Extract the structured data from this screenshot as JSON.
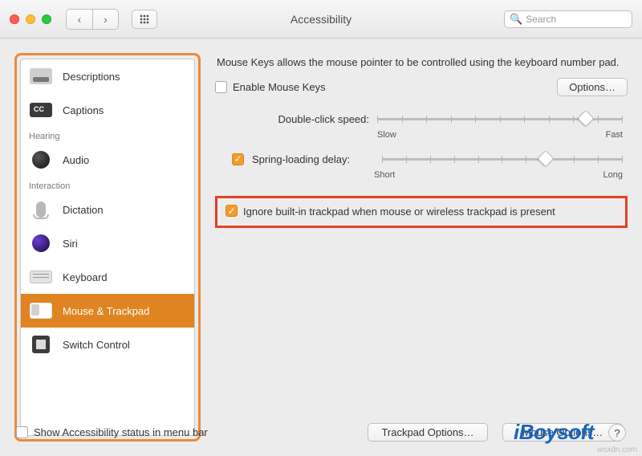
{
  "window": {
    "title": "Accessibility",
    "search_placeholder": "Search"
  },
  "sidebar": {
    "sections": [
      {
        "header": null,
        "items": [
          {
            "id": "descriptions",
            "label": "Descriptions"
          },
          {
            "id": "captions",
            "label": "Captions"
          }
        ]
      },
      {
        "header": "Hearing",
        "items": [
          {
            "id": "audio",
            "label": "Audio"
          }
        ]
      },
      {
        "header": "Interaction",
        "items": [
          {
            "id": "dictation",
            "label": "Dictation"
          },
          {
            "id": "siri",
            "label": "Siri"
          },
          {
            "id": "keyboard",
            "label": "Keyboard"
          },
          {
            "id": "mouse-trackpad",
            "label": "Mouse & Trackpad",
            "selected": true
          },
          {
            "id": "switch-control",
            "label": "Switch Control"
          }
        ]
      }
    ]
  },
  "main": {
    "intro": "Mouse Keys allows the mouse pointer to be controlled using the keyboard number pad.",
    "enable_mouse_keys": {
      "label": "Enable Mouse Keys",
      "checked": false
    },
    "options_button": "Options…",
    "sliders": {
      "dclick": {
        "label": "Double-click speed:",
        "min_label": "Slow",
        "max_label": "Fast",
        "value_pct": 85,
        "checked": null
      },
      "spring": {
        "label": "Spring-loading delay:",
        "min_label": "Short",
        "max_label": "Long",
        "value_pct": 68,
        "checked": true
      }
    },
    "ignore_trackpad": {
      "checked": true,
      "label": "Ignore built-in trackpad when mouse or wireless trackpad is present"
    },
    "trackpad_options_button": "Trackpad Options…",
    "mouse_options_button": "Mouse Options…"
  },
  "footer": {
    "show_status_label": "Show Accessibility status in menu bar",
    "show_status_checked": false,
    "brand": "iBoysoft",
    "watermark": "wsxdn.com",
    "help": "?"
  }
}
